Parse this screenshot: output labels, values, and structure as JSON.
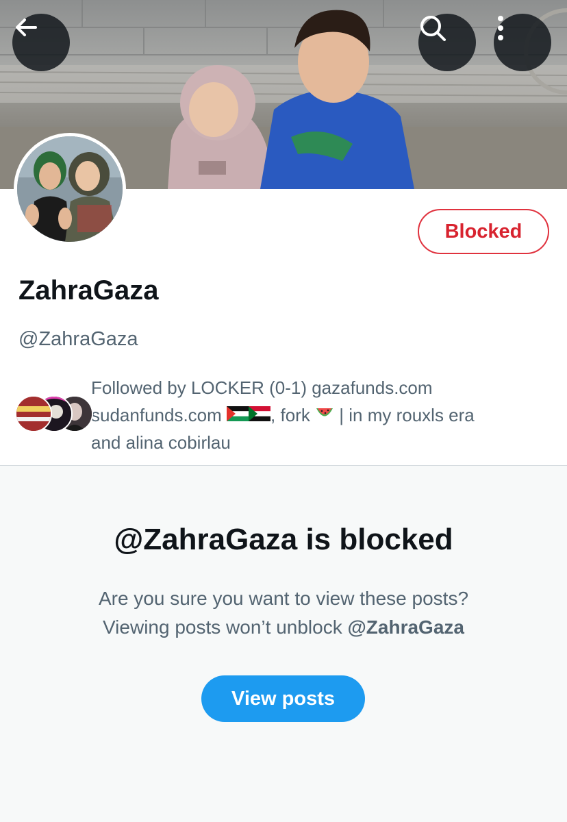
{
  "header": {
    "back_icon": "arrow-left-icon",
    "search_icon": "search-icon",
    "more_icon": "more-vertical-icon"
  },
  "profile": {
    "display_name": "ZahraGaza",
    "handle": "@ZahraGaza",
    "relationship_button": "Blocked",
    "followed_by": {
      "line1": "Followed by LOCKER (0-1) gazafunds.com",
      "line2_start": "sudanfunds.com",
      "line2_middle": ", fork",
      "line2_end": " | in my rouxls era",
      "line3": "and alina cobirlau"
    }
  },
  "blocked_notice": {
    "title": "@ZahraGaza is blocked",
    "line1": "Are you sure you want to view these posts?",
    "line2_prefix": "Viewing posts won’t unblock ",
    "line2_handle": "@ZahraGaza",
    "view_button": "View posts"
  },
  "colors": {
    "accent": "#1d9bf0",
    "blocked_red": "#d8232f",
    "text_primary": "#0f1419",
    "text_secondary": "#536471",
    "panel_bg": "#f7f9f9"
  }
}
